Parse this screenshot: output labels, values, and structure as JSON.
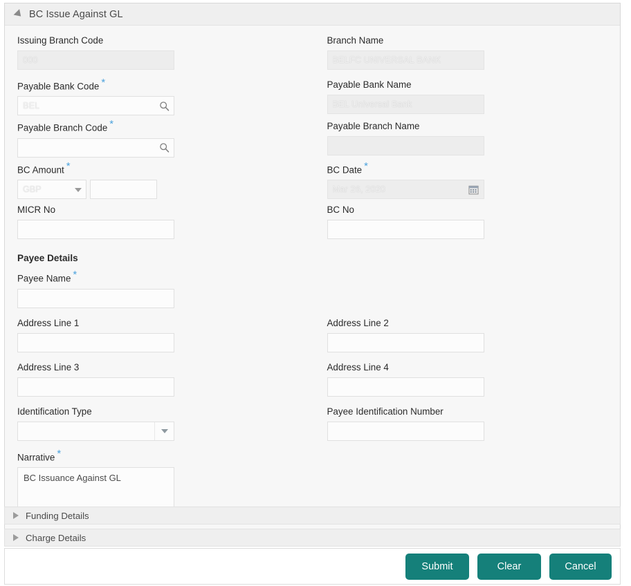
{
  "panel": {
    "title": "BC Issue Against GL",
    "collapse_icon": "caret-down-icon"
  },
  "fields": {
    "issuing_branch_code": {
      "label": "Issuing Branch Code",
      "value": "000",
      "readonly": true,
      "required": false
    },
    "branch_name": {
      "label": "Branch Name",
      "value": "BELFC UNIVERSAL BANK",
      "readonly": true,
      "required": false
    },
    "payable_bank_code": {
      "label": "Payable Bank Code",
      "value": "BEL",
      "required": true,
      "icon": "search-icon"
    },
    "payable_bank_name": {
      "label": "Payable Bank Name",
      "value": "BEL Universal Bank",
      "readonly": true,
      "required": false
    },
    "payable_branch_code": {
      "label": "Payable Branch Code",
      "value": "",
      "required": true,
      "icon": "search-icon"
    },
    "payable_branch_name": {
      "label": "Payable Branch Name",
      "value": "",
      "readonly": true,
      "required": false
    },
    "bc_amount": {
      "label": "BC Amount",
      "required": true,
      "currency": "GBP",
      "amount": ""
    },
    "bc_date": {
      "label": "BC Date",
      "value": "Mar 26, 2020",
      "required": true,
      "icon": "calendar-icon"
    },
    "micr_no": {
      "label": "MICR No",
      "value": "",
      "required": false
    },
    "bc_no": {
      "label": "BC No",
      "value": "",
      "required": false
    }
  },
  "payee": {
    "section_title": "Payee Details",
    "payee_name": {
      "label": "Payee Name",
      "value": "",
      "required": true
    },
    "address_line_1": {
      "label": "Address Line 1",
      "value": ""
    },
    "address_line_2": {
      "label": "Address Line 2",
      "value": ""
    },
    "address_line_3": {
      "label": "Address Line 3",
      "value": ""
    },
    "address_line_4": {
      "label": "Address Line 4",
      "value": ""
    },
    "identification_type": {
      "label": "Identification Type",
      "value": ""
    },
    "payee_identification_number": {
      "label": "Payee Identification Number",
      "value": ""
    }
  },
  "narrative": {
    "label": "Narrative",
    "value": "BC Issuance Against GL",
    "required": true
  },
  "accordions": [
    {
      "title": "Funding Details",
      "expanded": false,
      "icon": "caret-right-icon"
    },
    {
      "title": "Charge Details",
      "expanded": false,
      "icon": "caret-right-icon"
    }
  ],
  "footer": {
    "submit_label": "Submit",
    "clear_label": "Clear",
    "cancel_label": "Cancel",
    "button_color": "#15807a"
  }
}
